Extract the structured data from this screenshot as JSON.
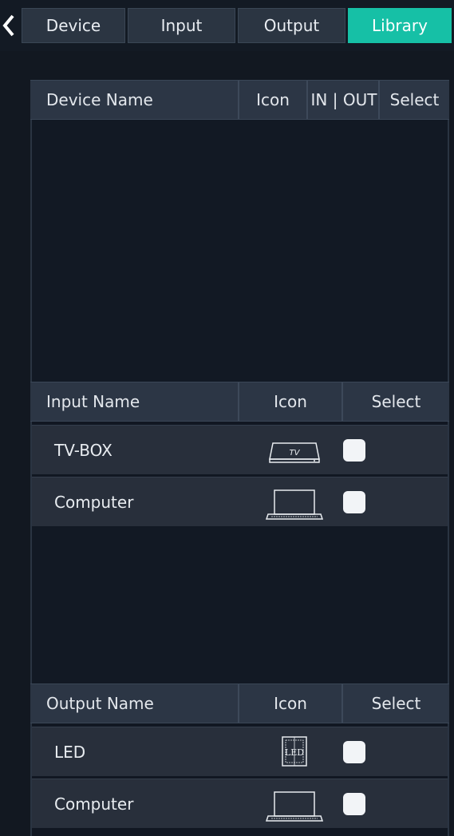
{
  "tabs": [
    {
      "label": "Device"
    },
    {
      "label": "Input"
    },
    {
      "label": "Output"
    },
    {
      "label": "Library",
      "active": true
    }
  ],
  "device_table": {
    "headers": [
      "Device Name",
      "Icon",
      "IN | OUT",
      "Select"
    ],
    "rows": []
  },
  "input_table": {
    "headers": [
      "Input Name",
      "Icon",
      "Select"
    ],
    "rows": [
      {
        "name": "TV-BOX",
        "icon": "tv-box-icon",
        "icon_text": "TV",
        "checked": false
      },
      {
        "name": "Computer",
        "icon": "laptop-icon",
        "checked": false
      }
    ]
  },
  "output_table": {
    "headers": [
      "Output Name",
      "Icon",
      "Select"
    ],
    "rows": [
      {
        "name": "LED",
        "icon": "led-screen-icon",
        "icon_text": "LED",
        "checked": false
      },
      {
        "name": "Computer",
        "icon": "laptop-icon",
        "checked": false
      }
    ]
  },
  "colors": {
    "accent": "#16c0a6",
    "background": "#121821",
    "header": "#2c3645",
    "row": "#282f3b"
  }
}
